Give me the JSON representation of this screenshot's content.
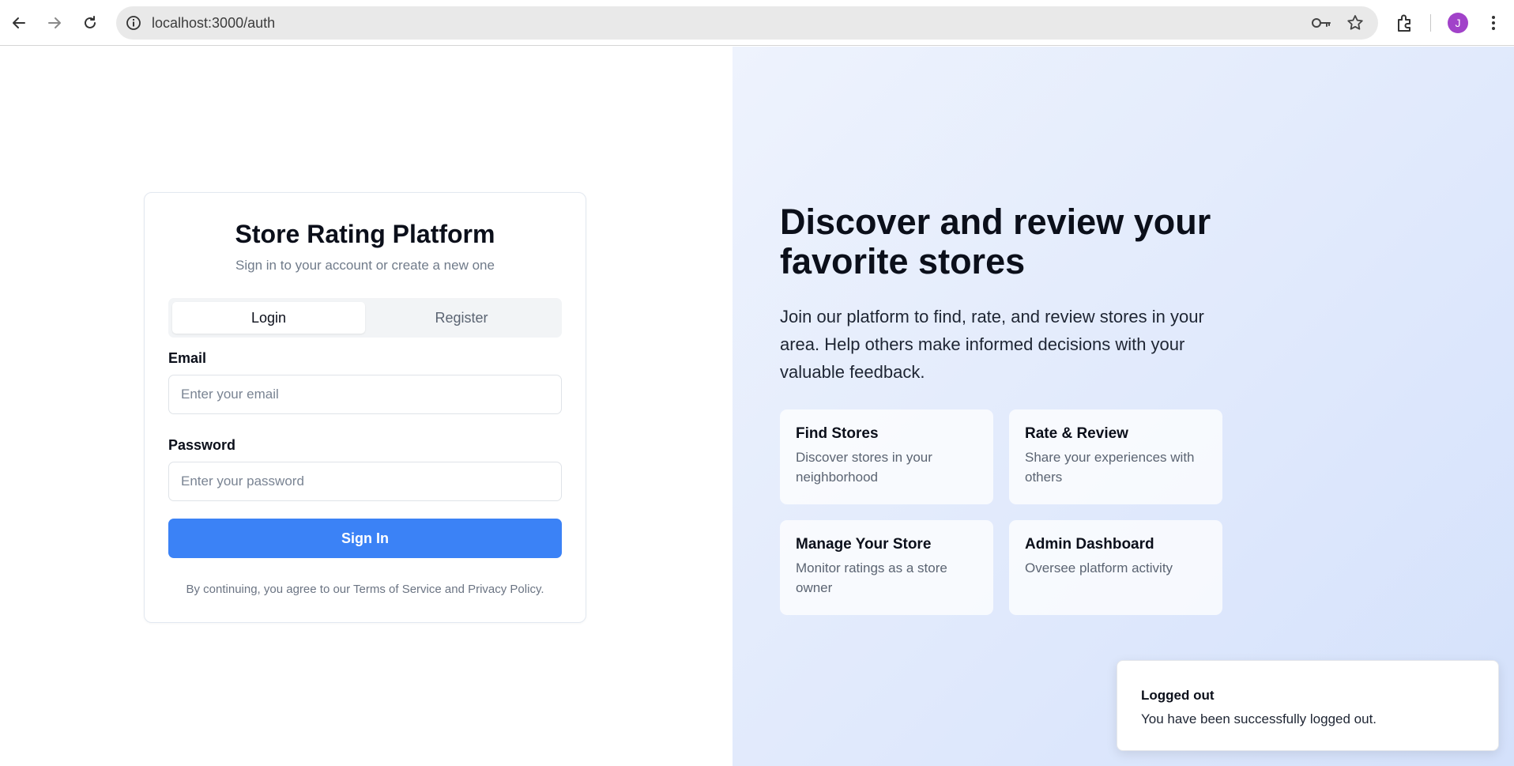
{
  "browser": {
    "url": "localhost:3000/auth",
    "profile_initial": "J",
    "icons": [
      "back-icon",
      "forward-icon",
      "reload-icon",
      "site-info-icon",
      "password-key-icon",
      "bookmark-star-icon",
      "extensions-icon",
      "menu-kebab-icon"
    ]
  },
  "auth_card": {
    "title": "Store Rating Platform",
    "subtitle": "Sign in to your account or create a new one",
    "tabs": [
      {
        "label": "Login",
        "active": true
      },
      {
        "label": "Register",
        "active": false
      }
    ],
    "email_label": "Email",
    "email_placeholder": "Enter your email",
    "email_value": "",
    "password_label": "Password",
    "password_placeholder": "Enter your password",
    "password_value": "",
    "submit_label": "Sign In",
    "terms": "By continuing, you agree to our Terms of Service and Privacy Policy."
  },
  "hero": {
    "headline": "Discover and review your favorite stores",
    "description": "Join our platform to find, rate, and review stores in your area. Help others make informed decisions with your valuable feedback.",
    "features": [
      {
        "title": "Find Stores",
        "description": "Discover stores in your neighborhood"
      },
      {
        "title": "Rate & Review",
        "description": "Share your experiences with others"
      },
      {
        "title": "Manage Your Store",
        "description": "Monitor ratings as a store owner"
      },
      {
        "title": "Admin Dashboard",
        "description": "Oversee platform activity"
      }
    ]
  },
  "toast": {
    "title": "Logged out",
    "message": "You have been successfully logged out."
  },
  "colors": {
    "primary": "#3b82f6",
    "avatar": "#a142c9",
    "hero_bg_start": "#eef3fd",
    "hero_bg_end": "#d4e1fb"
  }
}
